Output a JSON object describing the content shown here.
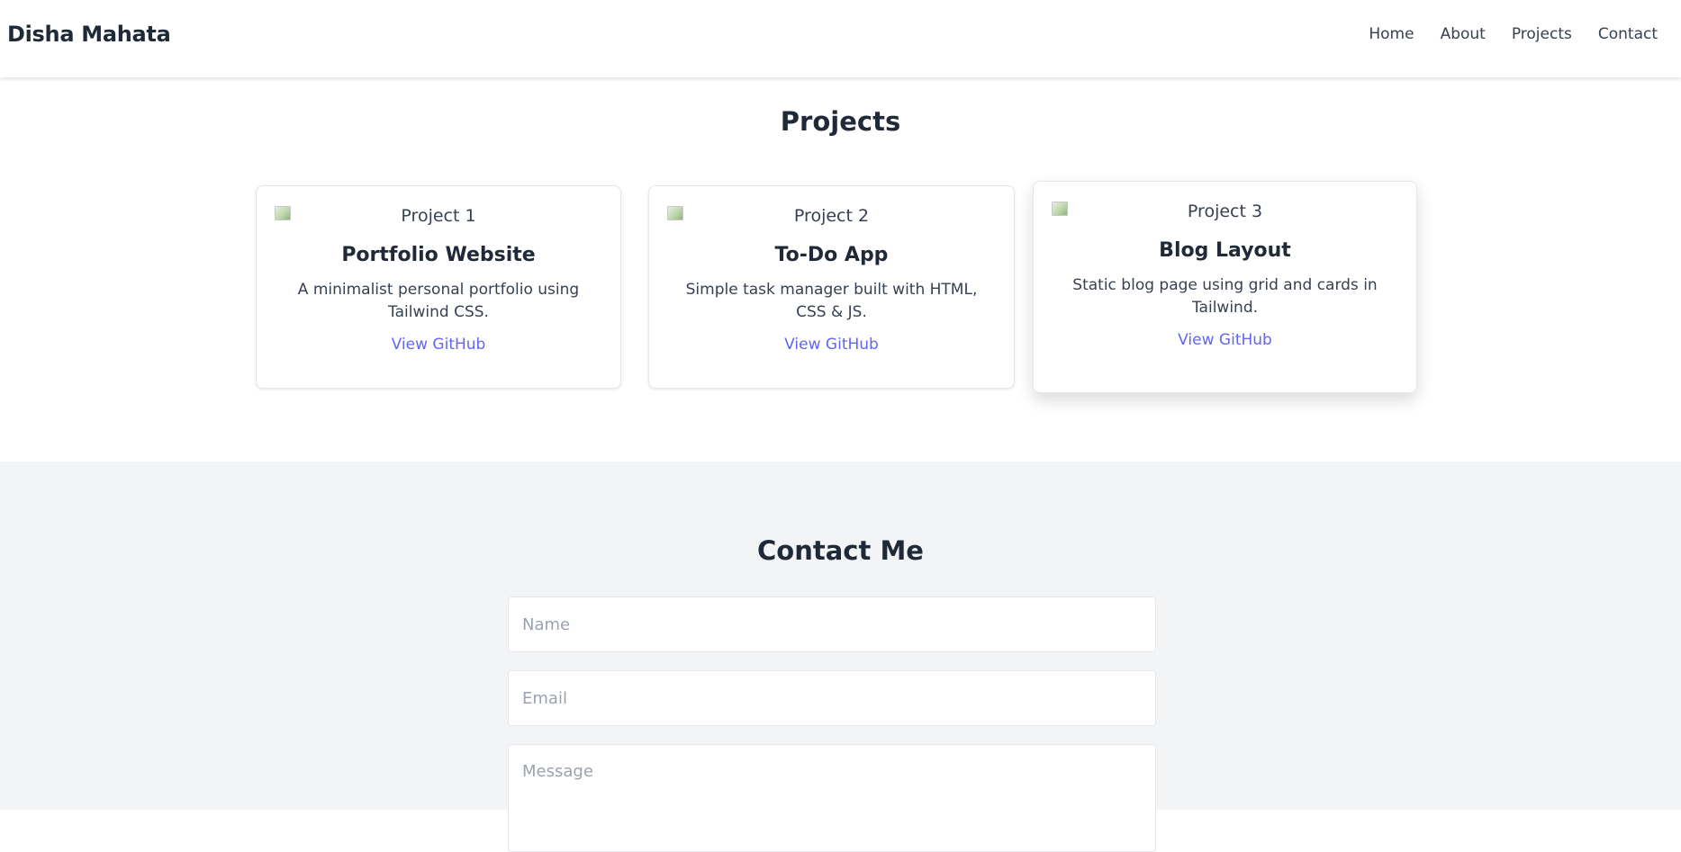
{
  "nav": {
    "brand": "Disha Mahata",
    "links": [
      "Home",
      "About",
      "Projects",
      "Contact"
    ]
  },
  "projects": {
    "title": "Projects",
    "cards": [
      {
        "image_alt": "Project 1",
        "title": "Portfolio Website",
        "description": "A minimalist personal portfolio using Tailwind CSS.",
        "link": "View GitHub"
      },
      {
        "image_alt": "Project 2",
        "title": "To-Do App",
        "description": "Simple task manager built with HTML, CSS & JS.",
        "link": "View GitHub"
      },
      {
        "image_alt": "Project 3",
        "title": "Blog Layout",
        "description": "Static blog page using grid and cards in Tailwind.",
        "link": "View GitHub"
      }
    ]
  },
  "contact": {
    "title": "Contact Me",
    "name_placeholder": "Name",
    "email_placeholder": "Email",
    "message_placeholder": "Message"
  },
  "colors": {
    "text": "#1f2937",
    "link": "#6366f1",
    "contact_bg": "#f3f4f6"
  }
}
